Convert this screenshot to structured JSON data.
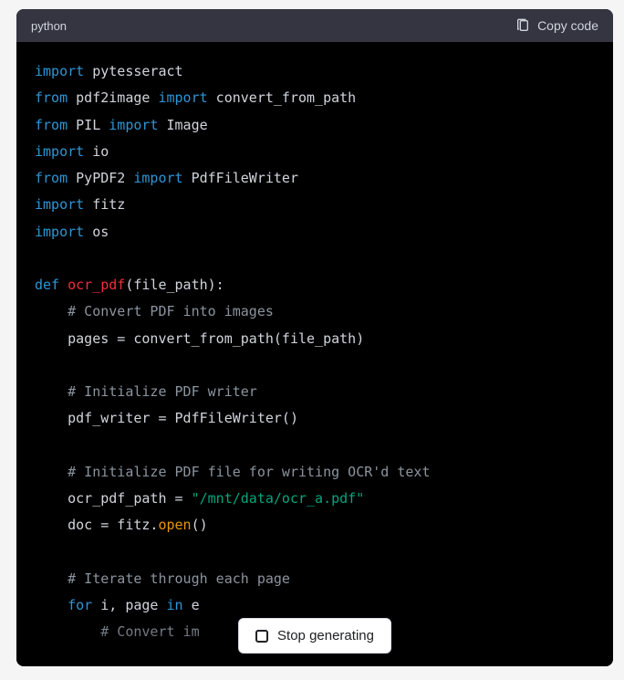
{
  "header": {
    "language": "python",
    "copy_label": "Copy code"
  },
  "code": {
    "line1_kw": "import",
    "line1_mod": " pytesseract",
    "line2_kw1": "from",
    "line2_mod1": " pdf2image ",
    "line2_kw2": "import",
    "line2_mod2": " convert_from_path",
    "line3_kw1": "from",
    "line3_mod1": " PIL ",
    "line3_kw2": "import",
    "line3_mod2": " Image",
    "line4_kw": "import",
    "line4_mod": " io",
    "line5_kw1": "from",
    "line5_mod1": " PyPDF2 ",
    "line5_kw2": "import",
    "line5_mod2": " PdfFileWriter",
    "line6_kw": "import",
    "line6_mod": " fitz",
    "line7_kw": "import",
    "line7_mod": " os",
    "line9_kw": "def",
    "line9_sp": " ",
    "line9_fn": "ocr_pdf",
    "line9_rest": "(file_path):",
    "line10_comment": "    # Convert PDF into images",
    "line11": "    pages = convert_from_path(file_path)",
    "line13_comment": "    # Initialize PDF writer",
    "line14": "    pdf_writer = PdfFileWriter()",
    "line16_comment": "    # Initialize PDF file for writing OCR'd text",
    "line17_pre": "    ocr_pdf_path = ",
    "line17_str": "\"/mnt/data/ocr_a.pdf\"",
    "line18_pre": "    doc = fitz.",
    "line18_method": "open",
    "line18_post": "()",
    "line20_comment": "    # Iterate through each page",
    "line21_indent": "    ",
    "line21_kw1": "for",
    "line21_mid": " i, page ",
    "line21_kw2": "in",
    "line21_rest": " e",
    "line22_comment": "        # Convert im"
  },
  "stop": {
    "label": "Stop generating"
  }
}
